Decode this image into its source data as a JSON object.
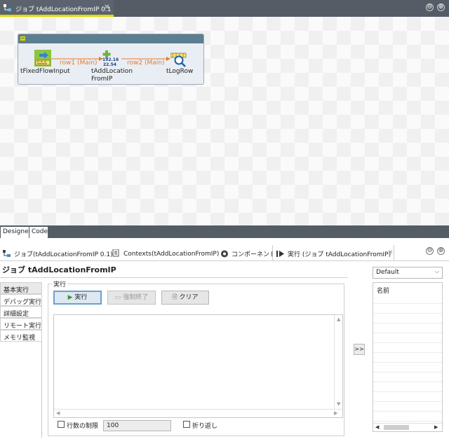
{
  "editor": {
    "tab_label": "ジョブ tAddLocationFromIP 0.1",
    "minimize_symbol": "⊖",
    "maximize_symbol": "⊕"
  },
  "diagram": {
    "components": [
      {
        "name": "tFixedFlowInput"
      },
      {
        "name": "tAddLocation\nFromIP",
        "line1": "tAddLocation",
        "line2": "FromIP"
      },
      {
        "name": "tLogRow"
      }
    ],
    "ip_icon_text": [
      "192.16",
      "22.54"
    ],
    "connections": [
      {
        "label": "row1 (Main)"
      },
      {
        "label": "row2 (Main)"
      }
    ]
  },
  "designer_tabs": [
    "Designer",
    "Code"
  ],
  "bottom_tabs": [
    {
      "label": "ジョブ(tAddLocationFromIP 0.1)",
      "icon": "job-icon"
    },
    {
      "label": "Contexts(tAddLocationFromIP)",
      "icon": "contexts-icon"
    },
    {
      "label": "コンポーネント",
      "icon": "component-icon"
    },
    {
      "label": "実行 (ジョブ tAddLocationFromIP)",
      "icon": "run-icon"
    }
  ],
  "job_title": "ジョブ tAddLocationFromIP",
  "side_menu": [
    "基本実行",
    "デバッグ実行",
    "詳細設定",
    "リモート実行",
    "メモリ監視"
  ],
  "run_group": {
    "label": "実行",
    "run_button": "実行",
    "kill_button": "強制終了",
    "clear_button": "クリア",
    "limit_label": "行数の制限",
    "limit_value": "100",
    "wrap_label": "折り返し"
  },
  "expand_button": ">>",
  "context": {
    "selected": "Default",
    "column_header": "名前"
  },
  "colors": {
    "accent_yellow": "#e2d900",
    "connection_orange": "#e87a2f",
    "subjob_header": "#5c7e91"
  }
}
